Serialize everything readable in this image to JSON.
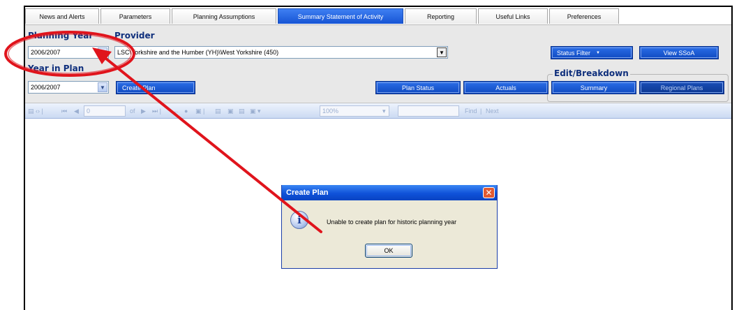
{
  "tabs": [
    {
      "label": "News and Alerts"
    },
    {
      "label": "Parameters"
    },
    {
      "label": "Planning Assumptions"
    },
    {
      "label": "Summary Statement of Activity"
    },
    {
      "label": "Reporting"
    },
    {
      "label": "Useful Links"
    },
    {
      "label": "Preferences"
    }
  ],
  "active_tab": "Summary Statement of Activity",
  "panel": {
    "planning_year_label": "Planning Year",
    "planning_year_value": "2006/2007",
    "provider_label": "Provider",
    "provider_value": "LSC\\Yorkshire and the Humber (YH)\\West Yorkshire (450)",
    "year_in_plan_label": "Year in Plan",
    "year_in_plan_value": "2006/2007",
    "create_plan": "Create Plan",
    "status_filter": "Status Filter",
    "view_ssoa": "View SSoA",
    "edit_breakdown_label": "Edit/Breakdown",
    "plan_status": "Plan Status",
    "actuals": "Actuals",
    "summary": "Summary",
    "regional_plans": "Regional Plans"
  },
  "toolbar": {
    "page_value": "0",
    "of": "of",
    "zoom": "100%",
    "find": "Find",
    "next": "Next"
  },
  "dialog": {
    "title": "Create Plan",
    "close": "✕",
    "info_glyph": "i",
    "message": "Unable to create plan for historic planning year",
    "ok": "OK"
  },
  "colors": {
    "accent_blue": "#1654d4",
    "label_navy": "#0f2f7c",
    "annotation_red": "#e0141c"
  },
  "icons": {
    "dialog": "info-icon",
    "dropdown": "chevron-down-icon",
    "close": "close-icon"
  }
}
